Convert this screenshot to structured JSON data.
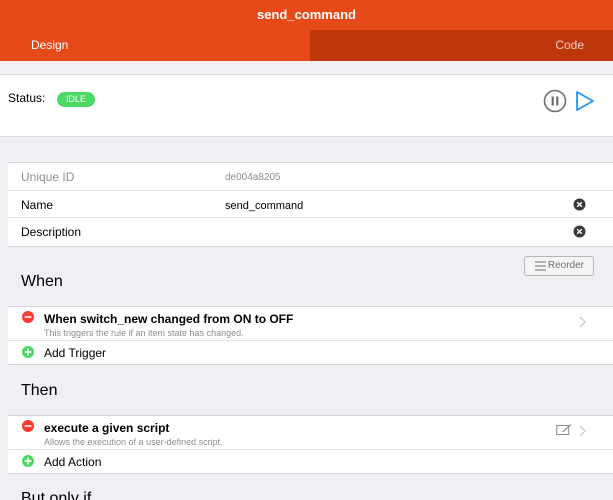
{
  "title": "send_command",
  "tabs": {
    "design": "Design",
    "code": "Code"
  },
  "status": {
    "label": "Status:",
    "badge": "IDLE"
  },
  "fields": {
    "uid_label": "Unique ID",
    "uid_value": "de004a8205",
    "name_label": "Name",
    "name_value": "send_command",
    "description_label": "Description",
    "description_value": ""
  },
  "reorder_label": "Reorder",
  "when": {
    "title": "When",
    "trigger_title": "When switch_new changed from ON to OFF",
    "trigger_sub": "This triggers the rule if an item state has changed.",
    "add_label": "Add Trigger"
  },
  "then": {
    "title": "Then",
    "action_title": "execute a given script",
    "action_sub": "Allows the execution of a user-defined script.",
    "add_label": "Add Action"
  },
  "but_only_if": {
    "title": "But only if"
  },
  "colors": {
    "accent": "#e64a19",
    "accent_dark": "#bf360c",
    "idle": "#4cd964",
    "play": "#2196f3",
    "remove": "#ff3b30",
    "add": "#4cd964"
  }
}
